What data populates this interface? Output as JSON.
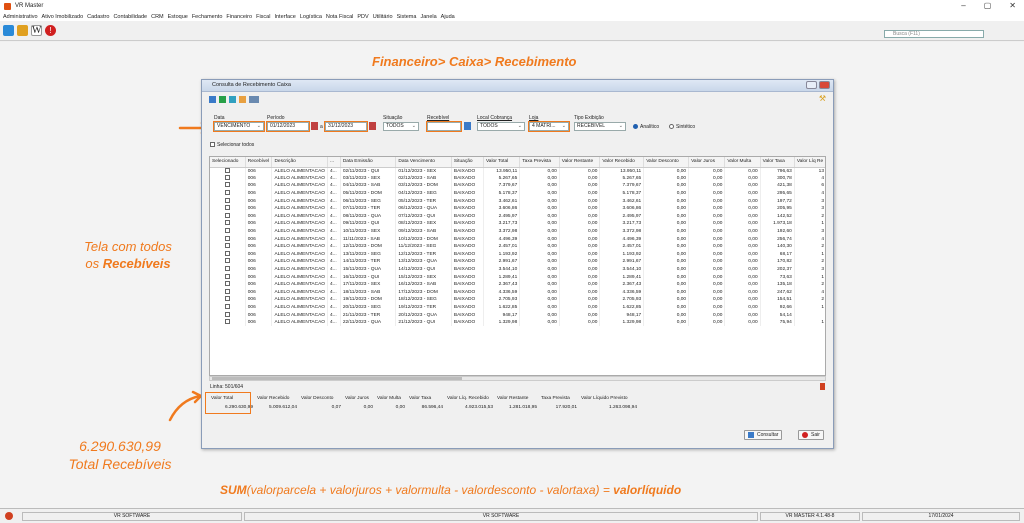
{
  "app": {
    "title": "VR Master",
    "win_controls": [
      "–",
      "▢",
      "✕"
    ]
  },
  "menu": [
    "Administrativo",
    "Ativo Imobilizado",
    "Cadastro",
    "Contabilidade",
    "CRM",
    "Estoque",
    "Fechamento",
    "Financeiro",
    "Fiscal",
    "Interface",
    "Logística",
    "Nota Fiscal",
    "PDV",
    "Utilitário",
    "Sistema",
    "Janela",
    "Ajuda"
  ],
  "toolbar": {
    "search_placeholder": "Busca (F11)",
    "w_label": "W"
  },
  "annotations": {
    "heading": "Financeiro> Caixa> Recebimento",
    "left_note_line1": "Tela com todos",
    "left_note_line2_prefix": "os ",
    "left_note_line2_bold": "Recebíveis",
    "total_value": "6.290.630,99",
    "total_label": "Total Recebíveis",
    "formula_sum": "SUM",
    "formula_body": "(valorparcela + valorjuros + valormulta - valordesconto - valortaxa) = ",
    "formula_result": "valorlíquido"
  },
  "window": {
    "title": "Consulta de Recebimento Caixa",
    "filters": {
      "data_label": "Data",
      "data_value": "VENCIMENTO",
      "periodo_label": "Período",
      "periodo_from": "01/12/2023",
      "periodo_sep": "a",
      "periodo_to": "31/12/2023",
      "situacao_label": "Situação",
      "situacao_value": "TODOS",
      "recebivel_label": "Recebível",
      "recebivel_value": "",
      "local_label": "Local Cobrança",
      "local_value": "TODOS",
      "loja_label": "Loja",
      "loja_value": "4 MATRI...",
      "tipo_label": "Tipo Exibição",
      "tipo_value": "RECEBIVEL",
      "radio_analitico": "Analítico",
      "radio_sintetico": "Sintético",
      "select_all": "Selecionar todos"
    },
    "columns": [
      "Selecionado",
      "Recebível",
      "Descrição",
      "...",
      "Data Emissão",
      "Data Vencimento",
      "Situação",
      "Valor Total",
      "Taxa Prevista",
      "Valor Restante",
      "Valor Recebido",
      "Valor Desconto",
      "Valor Juros",
      "Valor Multa",
      "Valor Taxa",
      "Valor Líq Re"
    ],
    "rows": [
      [
        "006",
        "ALELO ALIMENTACAO",
        "4...",
        "02/11/2023 - QUI",
        "01/12/2023 - SEX",
        "BAIXADO",
        "13.950,11",
        "0,00",
        "0,00",
        "13.950,11",
        "0,00",
        "0,00",
        "0,00",
        "796,63",
        "13"
      ],
      [
        "006",
        "ALELO ALIMENTACAO",
        "4...",
        "03/11/2023 - SEX",
        "02/12/2023 - SAB",
        "BAIXADO",
        "5.267,65",
        "0,00",
        "0,00",
        "5.267,65",
        "0,00",
        "0,00",
        "0,00",
        "300,78",
        "4"
      ],
      [
        "006",
        "ALELO ALIMENTACAO",
        "4...",
        "04/11/2023 - SAB",
        "03/12/2023 - DOM",
        "BAIXADO",
        "7.379,67",
        "0,00",
        "0,00",
        "7.379,67",
        "0,00",
        "0,00",
        "0,00",
        "421,38",
        "6"
      ],
      [
        "006",
        "ALELO ALIMENTACAO",
        "4...",
        "05/11/2023 - DOM",
        "04/12/2023 - SEG",
        "BAIXADO",
        "5.178,37",
        "0,00",
        "0,00",
        "5.178,37",
        "0,00",
        "0,00",
        "0,00",
        "295,65",
        "4"
      ],
      [
        "006",
        "ALELO ALIMENTACAO",
        "4...",
        "06/11/2023 - SEG",
        "05/12/2023 - TER",
        "BAIXADO",
        "3.462,61",
        "0,00",
        "0,00",
        "3.462,61",
        "0,00",
        "0,00",
        "0,00",
        "197,72",
        "3"
      ],
      [
        "006",
        "ALELO ALIMENTACAO",
        "4...",
        "07/11/2023 - TER",
        "06/12/2023 - QUA",
        "BAIXADO",
        "3.606,86",
        "0,00",
        "0,00",
        "3.606,86",
        "0,00",
        "0,00",
        "0,00",
        "205,95",
        "3"
      ],
      [
        "006",
        "ALELO ALIMENTACAO",
        "4...",
        "08/11/2023 - QUA",
        "07/12/2023 - QUI",
        "BAIXADO",
        "2.495,97",
        "0,00",
        "0,00",
        "2.495,97",
        "0,00",
        "0,00",
        "0,00",
        "142,52",
        "2"
      ],
      [
        "006",
        "ALELO ALIMENTACAO",
        "4...",
        "09/11/2023 - QUI",
        "08/12/2023 - SEX",
        "BAIXADO",
        "3.217,73",
        "0,00",
        "0,00",
        "3.217,73",
        "0,00",
        "0,00",
        "0,00",
        "1.973,18",
        "1"
      ],
      [
        "006",
        "ALELO ALIMENTACAO",
        "4...",
        "10/11/2023 - SEX",
        "09/12/2023 - SAB",
        "BAIXADO",
        "3.372,98",
        "0,00",
        "0,00",
        "3.372,98",
        "0,00",
        "0,00",
        "0,00",
        "192,60",
        "3"
      ],
      [
        "006",
        "ALELO ALIMENTACAO",
        "4...",
        "11/11/2023 - SAB",
        "10/12/2023 - DOM",
        "BAIXADO",
        "4.496,39",
        "0,00",
        "0,00",
        "4.496,39",
        "0,00",
        "0,00",
        "0,00",
        "256,74",
        "4"
      ],
      [
        "006",
        "ALELO ALIMENTACAO",
        "4...",
        "12/11/2023 - DOM",
        "11/12/2023 - SEG",
        "BAIXADO",
        "2.457,01",
        "0,00",
        "0,00",
        "2.457,01",
        "0,00",
        "0,00",
        "0,00",
        "140,30",
        "2"
      ],
      [
        "006",
        "ALELO ALIMENTACAO",
        "4...",
        "13/11/2023 - SEG",
        "12/12/2023 - TER",
        "BAIXADO",
        "1.193,92",
        "0,00",
        "0,00",
        "1.193,92",
        "0,00",
        "0,00",
        "0,00",
        "68,17",
        "1"
      ],
      [
        "006",
        "ALELO ALIMENTACAO",
        "4...",
        "14/11/2023 - TER",
        "13/12/2023 - QUA",
        "BAIXADO",
        "2.991,67",
        "0,00",
        "0,00",
        "2.991,67",
        "0,00",
        "0,00",
        "0,00",
        "170,82",
        "2"
      ],
      [
        "006",
        "ALELO ALIMENTACAO",
        "4...",
        "15/11/2023 - QUA",
        "14/12/2023 - QUI",
        "BAIXADO",
        "3.544,10",
        "0,00",
        "0,00",
        "3.544,10",
        "0,00",
        "0,00",
        "0,00",
        "202,37",
        "3"
      ],
      [
        "006",
        "ALELO ALIMENTACAO",
        "4...",
        "16/11/2023 - QUI",
        "15/12/2023 - SEX",
        "BAIXADO",
        "1.289,41",
        "0,00",
        "0,00",
        "1.289,41",
        "0,00",
        "0,00",
        "0,00",
        "73,63",
        "1"
      ],
      [
        "006",
        "ALELO ALIMENTACAO",
        "4...",
        "17/11/2023 - SEX",
        "16/12/2023 - SAB",
        "BAIXADO",
        "2.367,43",
        "0,00",
        "0,00",
        "2.367,43",
        "0,00",
        "0,00",
        "0,00",
        "135,18",
        "2"
      ],
      [
        "006",
        "ALELO ALIMENTACAO",
        "4...",
        "18/11/2023 - SAB",
        "17/12/2023 - DOM",
        "BAIXADO",
        "4.336,59",
        "0,00",
        "0,00",
        "4.336,59",
        "0,00",
        "0,00",
        "0,00",
        "247,62",
        "4"
      ],
      [
        "006",
        "ALELO ALIMENTACAO",
        "4...",
        "19/11/2023 - DOM",
        "18/12/2023 - SEG",
        "BAIXADO",
        "2.705,93",
        "0,00",
        "0,00",
        "2.705,93",
        "0,00",
        "0,00",
        "0,00",
        "154,51",
        "2"
      ],
      [
        "006",
        "ALELO ALIMENTACAO",
        "4...",
        "20/11/2023 - SEG",
        "19/12/2023 - TER",
        "BAIXADO",
        "1.622,85",
        "0,00",
        "0,00",
        "1.622,85",
        "0,00",
        "0,00",
        "0,00",
        "92,66",
        "1"
      ],
      [
        "006",
        "ALELO ALIMENTACAO",
        "4...",
        "21/11/2023 - TER",
        "20/12/2023 - QUA",
        "BAIXADO",
        "948,17",
        "0,00",
        "0,00",
        "948,17",
        "0,00",
        "0,00",
        "0,00",
        "54,14",
        ""
      ],
      [
        "006",
        "ALELO ALIMENTACAO",
        "4...",
        "22/11/2023 - QUA",
        "21/12/2023 - QUI",
        "BAIXADO",
        "1.329,98",
        "0,00",
        "0,00",
        "1.329,98",
        "0,00",
        "0,00",
        "0,00",
        "75,94",
        "1"
      ]
    ],
    "linha": "Linha: 501/604",
    "totals_labels": [
      "Valor Total",
      "Valor Recebido",
      "Valor Desconto",
      "Valor Juros",
      "Valor Multa",
      "Valor Taxa",
      "Valor Líq. Recebido",
      "Valor Restante",
      "Taxa Prevista",
      "Valor Líquido Previsto"
    ],
    "totals_values": [
      "6.290.630,99",
      "5.009.612,04",
      "0,07",
      "0,00",
      "0,00",
      "86.596,44",
      "4.923.015,53",
      "1.281.018,95",
      "17.920,01",
      "1.263.098,94"
    ],
    "btn_consultar": "Consultar",
    "btn_sair": "Sair"
  },
  "statusbar": {
    "left": "VR SOFTWARE",
    "mid": "VR SOFTWARE",
    "version": "VR MASTER 4.1.48-8",
    "date": "17/01/2024"
  },
  "colors": {
    "accent": "#f07a1e",
    "window_border": "#8a9cb8"
  }
}
